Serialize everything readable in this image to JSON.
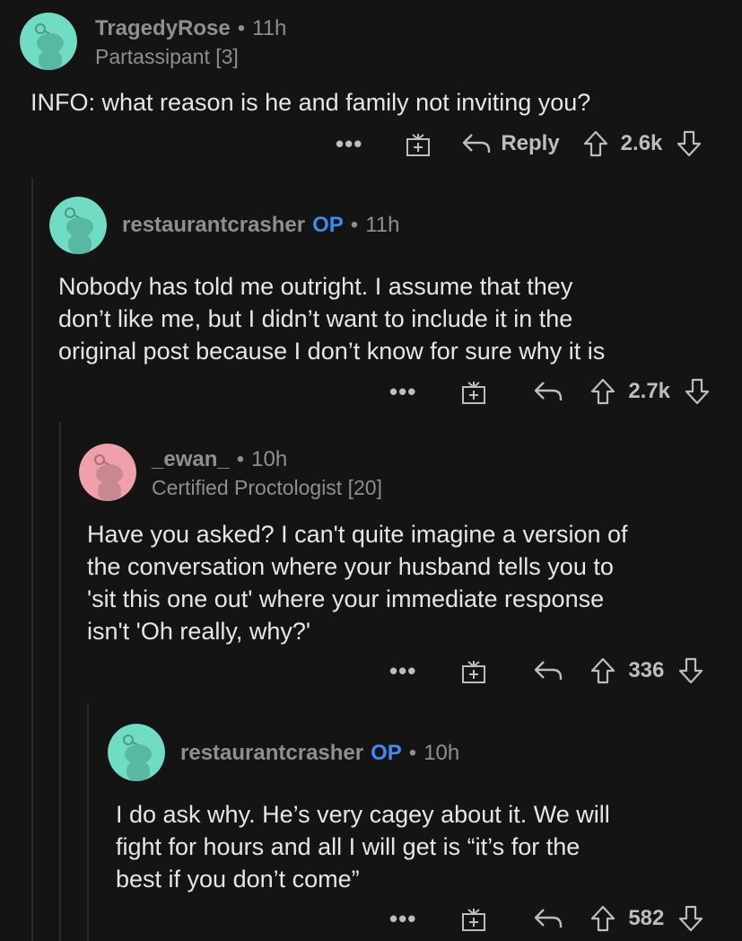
{
  "theme": {
    "background": "#141414",
    "op_color": "#3f8bf2",
    "teal_avatar": "#6fdcc3",
    "pink_avatar": "#f0a0aa"
  },
  "comments": [
    {
      "username": "TragedyRose",
      "time": "11h",
      "flair": "Partassipant [3]",
      "body": "INFO: what reason is he and family not inviting you?",
      "reply_label": "Reply",
      "votes": "2.6k",
      "avatar_color": "#6fdcc3"
    },
    {
      "username": "restaurantcrasher",
      "op_label": "OP",
      "time": "11h",
      "body": "Nobody has told me outright. I assume that they\ndon’t like me, but I didn’t want to include it in the\noriginal post because I don’t know for sure why it is",
      "votes": "2.7k",
      "avatar_color": "#6fdcc3"
    },
    {
      "username": "_ewan_",
      "time": "10h",
      "flair": "Certified Proctologist [20]",
      "body": "Have you asked? I can't quite imagine a version of\nthe conversation where your husband tells you to\n'sit this one out' where your immediate response\nisn't 'Oh really, why?'",
      "votes": "336",
      "avatar_color": "#f0a0aa"
    },
    {
      "username": "restaurantcrasher",
      "op_label": "OP",
      "time": "10h",
      "body": "I do ask why. He’s very cagey about it. We will\nfight for hours and all I will get is “it’s for the\nbest if you don’t come”",
      "votes": "582",
      "avatar_color": "#6fdcc3"
    }
  ],
  "common": {
    "separator": "•",
    "more_label": "•••"
  }
}
